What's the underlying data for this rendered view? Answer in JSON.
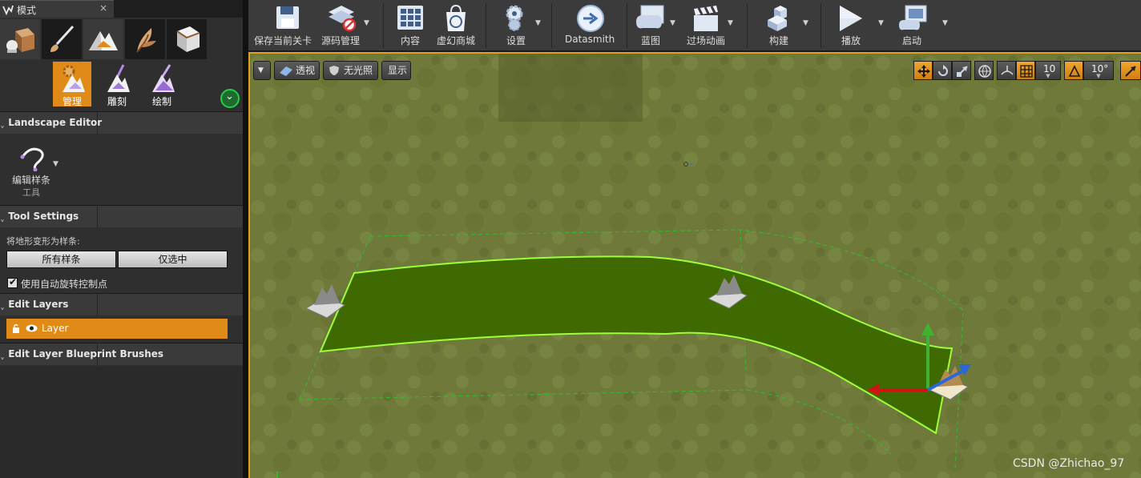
{
  "tab": {
    "title": "模式",
    "close": "×"
  },
  "mode_buttons": [
    {
      "name": "place-mode"
    },
    {
      "name": "paint-mode"
    },
    {
      "name": "landscape-mode"
    },
    {
      "name": "foliage-mode"
    },
    {
      "name": "geometry-mode"
    }
  ],
  "landscape_tools": [
    {
      "label": "管理",
      "active": true
    },
    {
      "label": "雕刻",
      "active": false
    },
    {
      "label": "绘制",
      "active": false
    }
  ],
  "sections": {
    "landscape_editor": "Landscape Editor",
    "tool_settings": "Tool Settings",
    "edit_layers": "Edit Layers",
    "edit_layer_blueprint_brushes": "Edit Layer Blueprint Brushes"
  },
  "spline_tool": {
    "label": "编辑样条",
    "sublabel": "工具"
  },
  "tool_settings": {
    "deform_label": "将地形变形为样条:",
    "all_splines": "所有样条",
    "selected_only": "仅选中",
    "auto_rotate_label": "使用自动旋转控制点",
    "auto_rotate_checked": true
  },
  "layers": [
    {
      "name": "Layer"
    }
  ],
  "toolbar": {
    "save": "保存当前关卡",
    "source_control": "源码管理",
    "content": "内容",
    "marketplace": "虚幻商城",
    "settings": "设置",
    "datasmith": "Datasmith",
    "blueprints": "蓝图",
    "cinematics": "过场动画",
    "build": "构建",
    "play": "播放",
    "launch": "启动"
  },
  "viewport": {
    "perspective": "透视",
    "unlit": "无光照",
    "show": "显示",
    "grid_snap": "10",
    "rotation_snap": "10°"
  },
  "watermark": "CSDN @Zhichao_97",
  "colors": {
    "accent": "#e08a18",
    "grass": "#6f7a3a",
    "spline_ribbon": "#3f6a02",
    "spline_edge": "#9cff3a"
  }
}
